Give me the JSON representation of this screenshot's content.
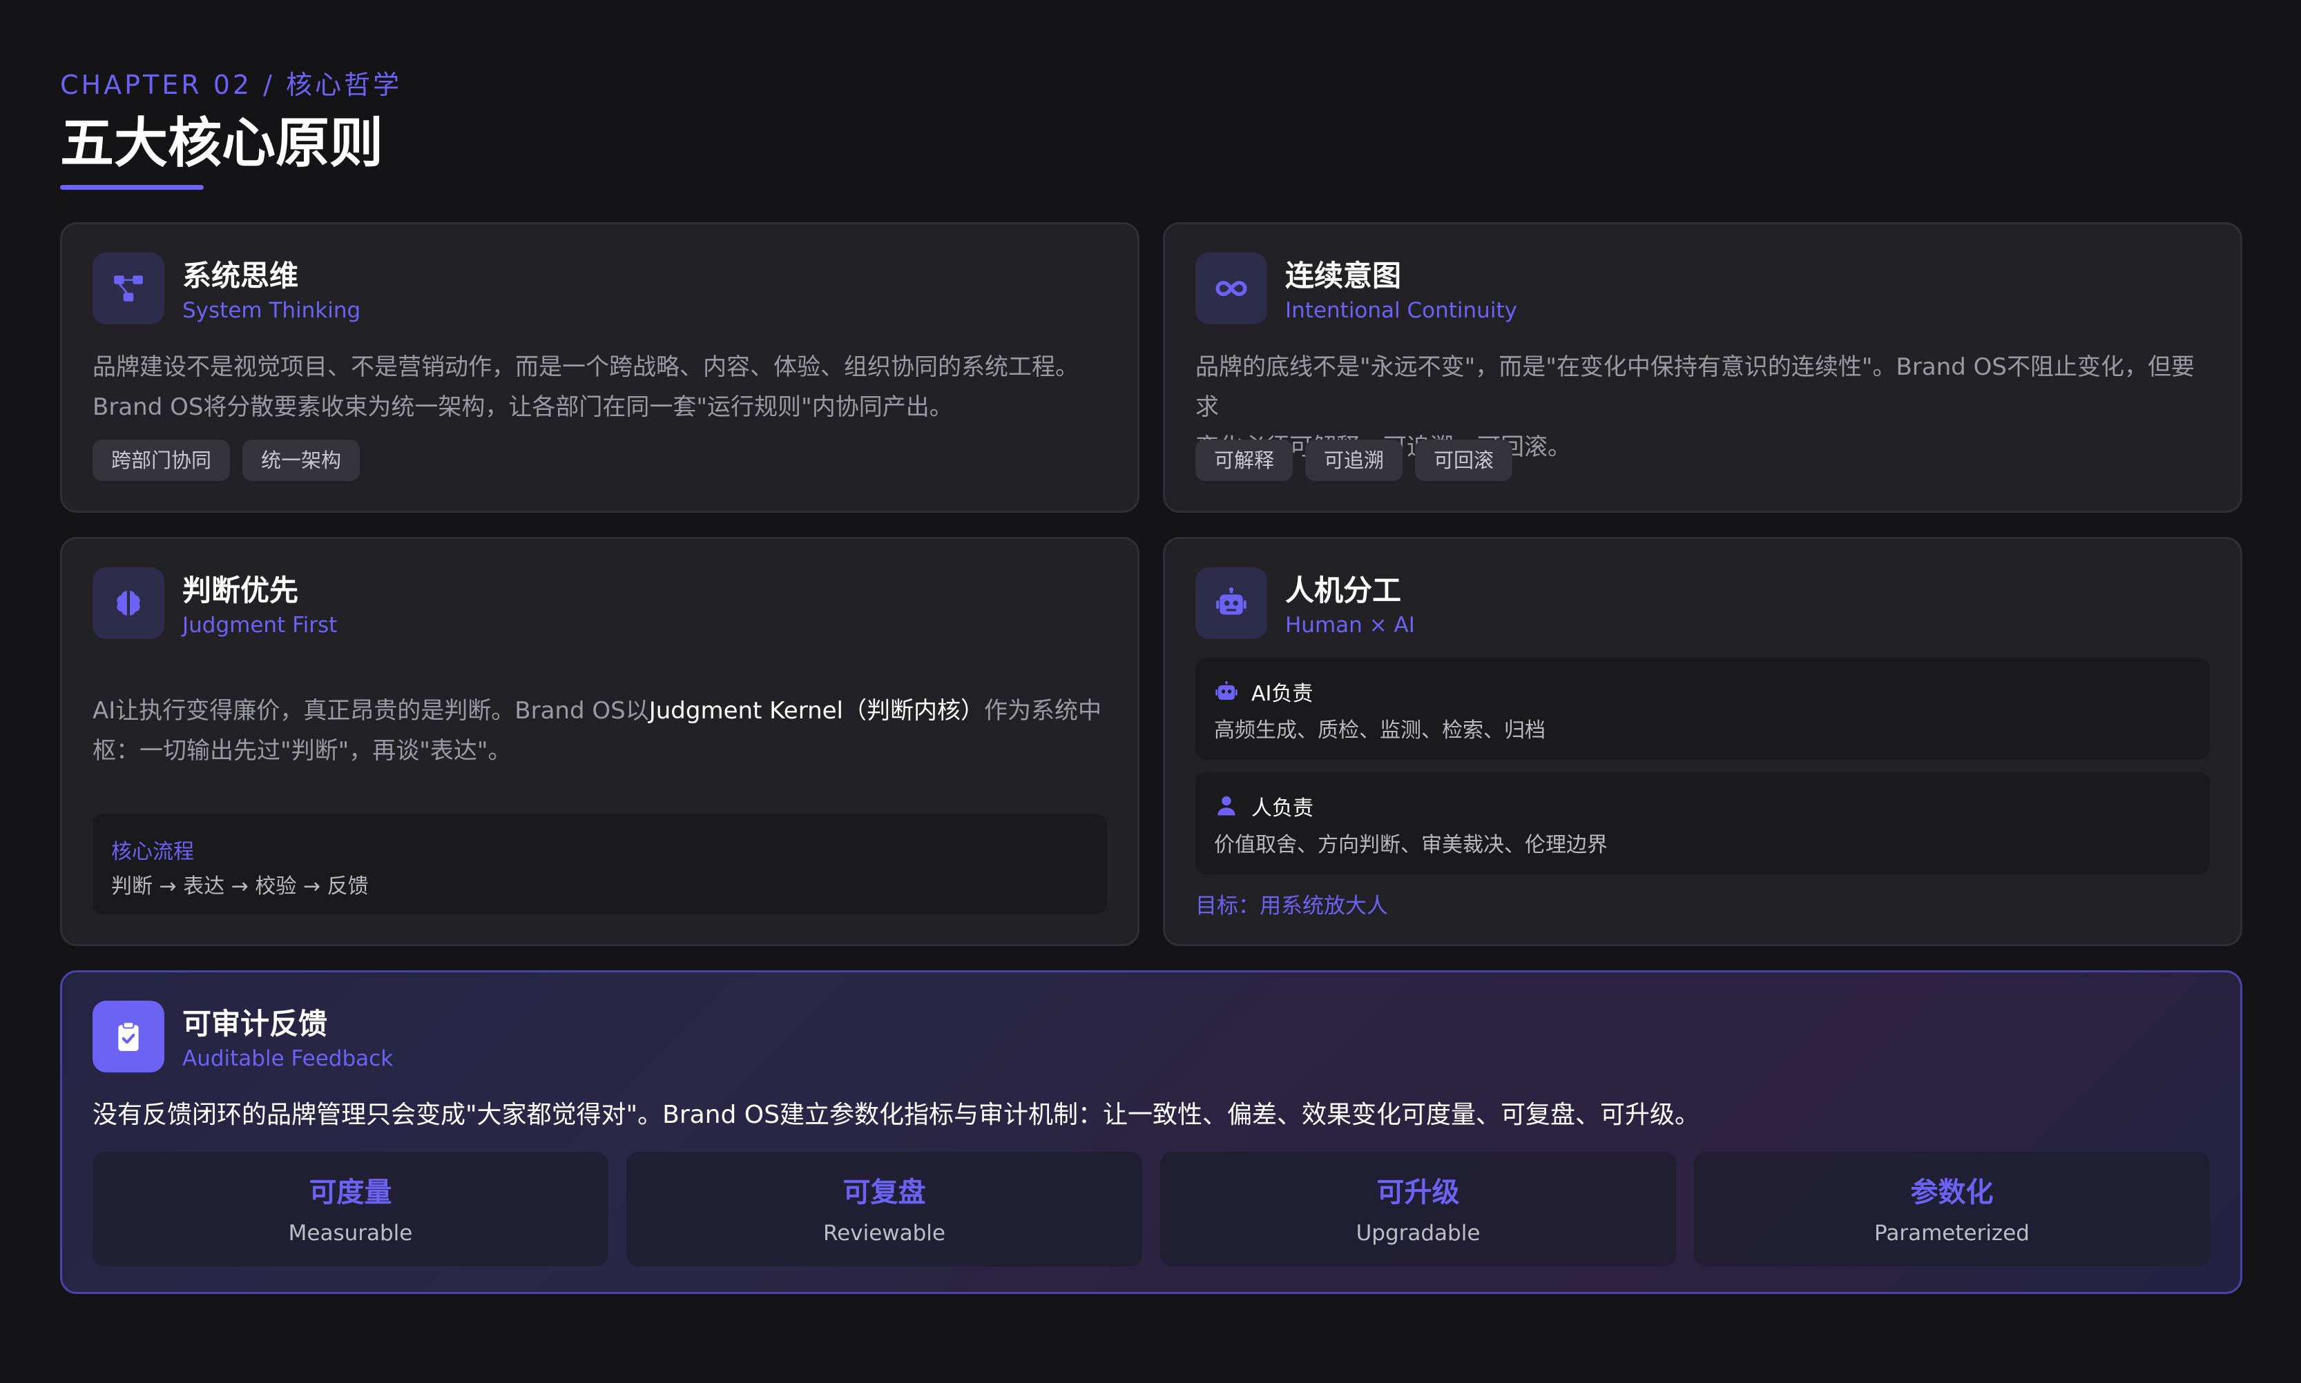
{
  "header": {
    "chapter": "CHAPTER 02 / 核心哲学",
    "title": "五大核心原则"
  },
  "colors": {
    "accent": "#6c63f5",
    "background": "#141416",
    "card": "#222226"
  },
  "cards": {
    "system": {
      "icon": "network-icon",
      "title": "系统思维",
      "subtitle": "System Thinking",
      "desc_line1": "品牌建设不是视觉项目、不是营销动作，而是一个跨战略、内容、体验、组织协同的系统工程。",
      "desc_line2": "Brand OS将分散要素收束为统一架构，让各部门在同一套\"运行规则\"内协同产出。",
      "tags": [
        "跨部门协同",
        "统一架构"
      ]
    },
    "continuity": {
      "icon": "infinity-icon",
      "title": "连续意图",
      "subtitle": "Intentional Continuity",
      "desc_line1": "品牌的底线不是\"永远不变\"，而是\"在变化中保持有意识的连续性\"。Brand OS不阻止变化，但要求",
      "desc_line2": "变化必须可解释、可追溯、可回滚。",
      "tags": [
        "可解释",
        "可追溯",
        "可回滚"
      ]
    },
    "judgment": {
      "icon": "brain-icon",
      "title": "判断优先",
      "subtitle": "Judgment First",
      "desc_pre": "AI让执行变得廉价，真正昂贵的是判断。Brand OS以",
      "desc_hl": "Judgment Kernel（判断内核）",
      "desc_post": "作为系统中",
      "desc_line2": "枢：一切输出先过\"判断\"，再谈\"表达\"。",
      "flow_title": "核心流程",
      "flow_text": "判断 → 表达 → 校验 → 反馈"
    },
    "human_ai": {
      "icon": "robot-icon",
      "title": "人机分工",
      "subtitle": "Human × AI",
      "ai_label": "AI负责",
      "ai_text": "高频生成、质检、监测、检索、归档",
      "human_label": "人负责",
      "human_text": "价值取舍、方向判断、审美裁决、伦理边界",
      "goal": "目标：用系统放大人"
    },
    "feedback": {
      "icon": "clipboard-check-icon",
      "title": "可审计反馈",
      "subtitle": "Auditable Feedback",
      "desc": "没有反馈闭环的品牌管理只会变成\"大家都觉得对\"。Brand OS建立参数化指标与审计机制：让一致性、偏差、效果变化可度量、可复盘、可升级。",
      "metrics": [
        {
          "zh": "可度量",
          "en": "Measurable"
        },
        {
          "zh": "可复盘",
          "en": "Reviewable"
        },
        {
          "zh": "可升级",
          "en": "Upgradable"
        },
        {
          "zh": "参数化",
          "en": "Parameterized"
        }
      ]
    }
  }
}
